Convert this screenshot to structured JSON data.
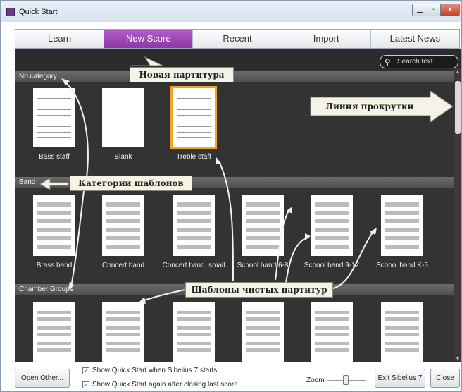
{
  "window": {
    "title": "Quick Start",
    "minimize": "▁",
    "maximize": "▫",
    "close": "x"
  },
  "tabs": [
    {
      "label": "Learn"
    },
    {
      "label": "New Score",
      "active": true
    },
    {
      "label": "Recent"
    },
    {
      "label": "Import"
    },
    {
      "label": "Latest News"
    }
  ],
  "search": {
    "placeholder": "Search text",
    "icon": "search-icon"
  },
  "categories": [
    {
      "name": "No category",
      "templates": [
        "Bass staff",
        "Blank",
        "Treble staff"
      ]
    },
    {
      "name": "Band",
      "templates": [
        "Brass band",
        "Concert band",
        "Concert band, small",
        "School band 6-8",
        "School band 9-12",
        "School band K-5"
      ]
    },
    {
      "name": "Chamber Groups",
      "templates": [
        "",
        "",
        "",
        "",
        "",
        ""
      ]
    }
  ],
  "selected_template": "Treble staff",
  "annotations": {
    "new_score": "Новая партитура",
    "scroll_line": "Линия прокрутки",
    "template_categories": "Категории шаблонов",
    "blank_templates": "Шаблоны чистых партитур"
  },
  "footer": {
    "open_other": "Open Other...",
    "show_on_start": "Show Quick Start when Sibelius 7 starts",
    "show_after_close": "Show Quick Start again after closing last score",
    "zoom_label": "Zoom",
    "exit": "Exit Sibelius 7",
    "close": "Close"
  },
  "colors": {
    "accent": "#9b46b6",
    "selection": "#f3a224",
    "panel": "#2c2c2c"
  }
}
